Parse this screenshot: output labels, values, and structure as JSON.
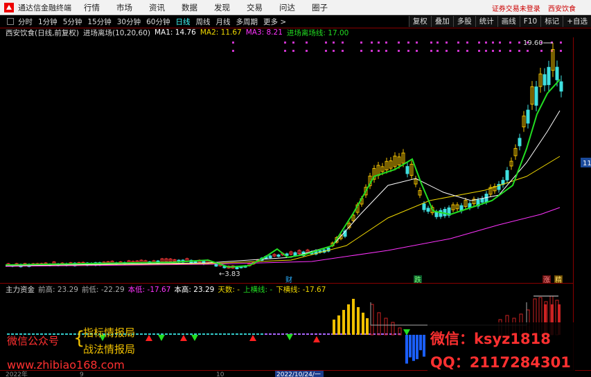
{
  "app": {
    "title": "通达信金融终端",
    "menus": [
      "行情",
      "市场",
      "资讯",
      "数据",
      "发现",
      "交易",
      "问达",
      "圈子"
    ],
    "right_status": [
      "证券交易未登录",
      "西安饮食"
    ]
  },
  "periods": [
    "分时",
    "1分钟",
    "5分钟",
    "15分钟",
    "30分钟",
    "60分钟",
    "日线",
    "周线",
    "月线",
    "多周期",
    "更多 >"
  ],
  "active_period": "日线",
  "tools": [
    "复权",
    "叠加",
    "多股",
    "统计",
    "画线",
    "F10",
    "标记",
    "+自选"
  ],
  "main_info": {
    "stock": "西安饮食(日线,前复权)",
    "indicator": "进场离场(10,20,60)",
    "ma1_label": "MA1: 14.76",
    "ma2_label": "MA2: 11.67",
    "ma3_label": "MA3: 8.21",
    "entry_label": "进场离场线: 17.00"
  },
  "chart_labels": {
    "high_label": "19.60",
    "low_label": "←3.83",
    "side_label": "11",
    "tag_cai": "财",
    "tag_die": "跌",
    "tag_zhang": "涨",
    "tag_jing": "精"
  },
  "sub_info": {
    "name": "主力资金",
    "prev_high": "前高: 23.29",
    "prev_low": "前低: -22.29",
    "this_low": "本低: -17.67",
    "this_high": "本高: 23.29",
    "tian_shu": "天数: -",
    "up_line": "上横线: -",
    "down_line": "下横线: -17.67"
  },
  "date_axis": {
    "left": "2022年",
    "mid1": "9",
    "mid2": "10",
    "highlight": "2022/10/24/一"
  },
  "watermark": {
    "left_line1": "微信公众号",
    "left_line2a": "指标情报局",
    "left_line2b": "战法情报局",
    "left_url": "www.zhibiao168.com",
    "right_line1": "微信：ksyz1818",
    "right_line2": "QQ：2117284301"
  },
  "colors": {
    "up": "#ff3a3a",
    "down": "#3fe0e0",
    "ma1": "#ffffff",
    "ma2": "#f0d800",
    "ma3": "#ff33ff",
    "entry": "#22dd22",
    "bull": "#f0c000"
  }
}
